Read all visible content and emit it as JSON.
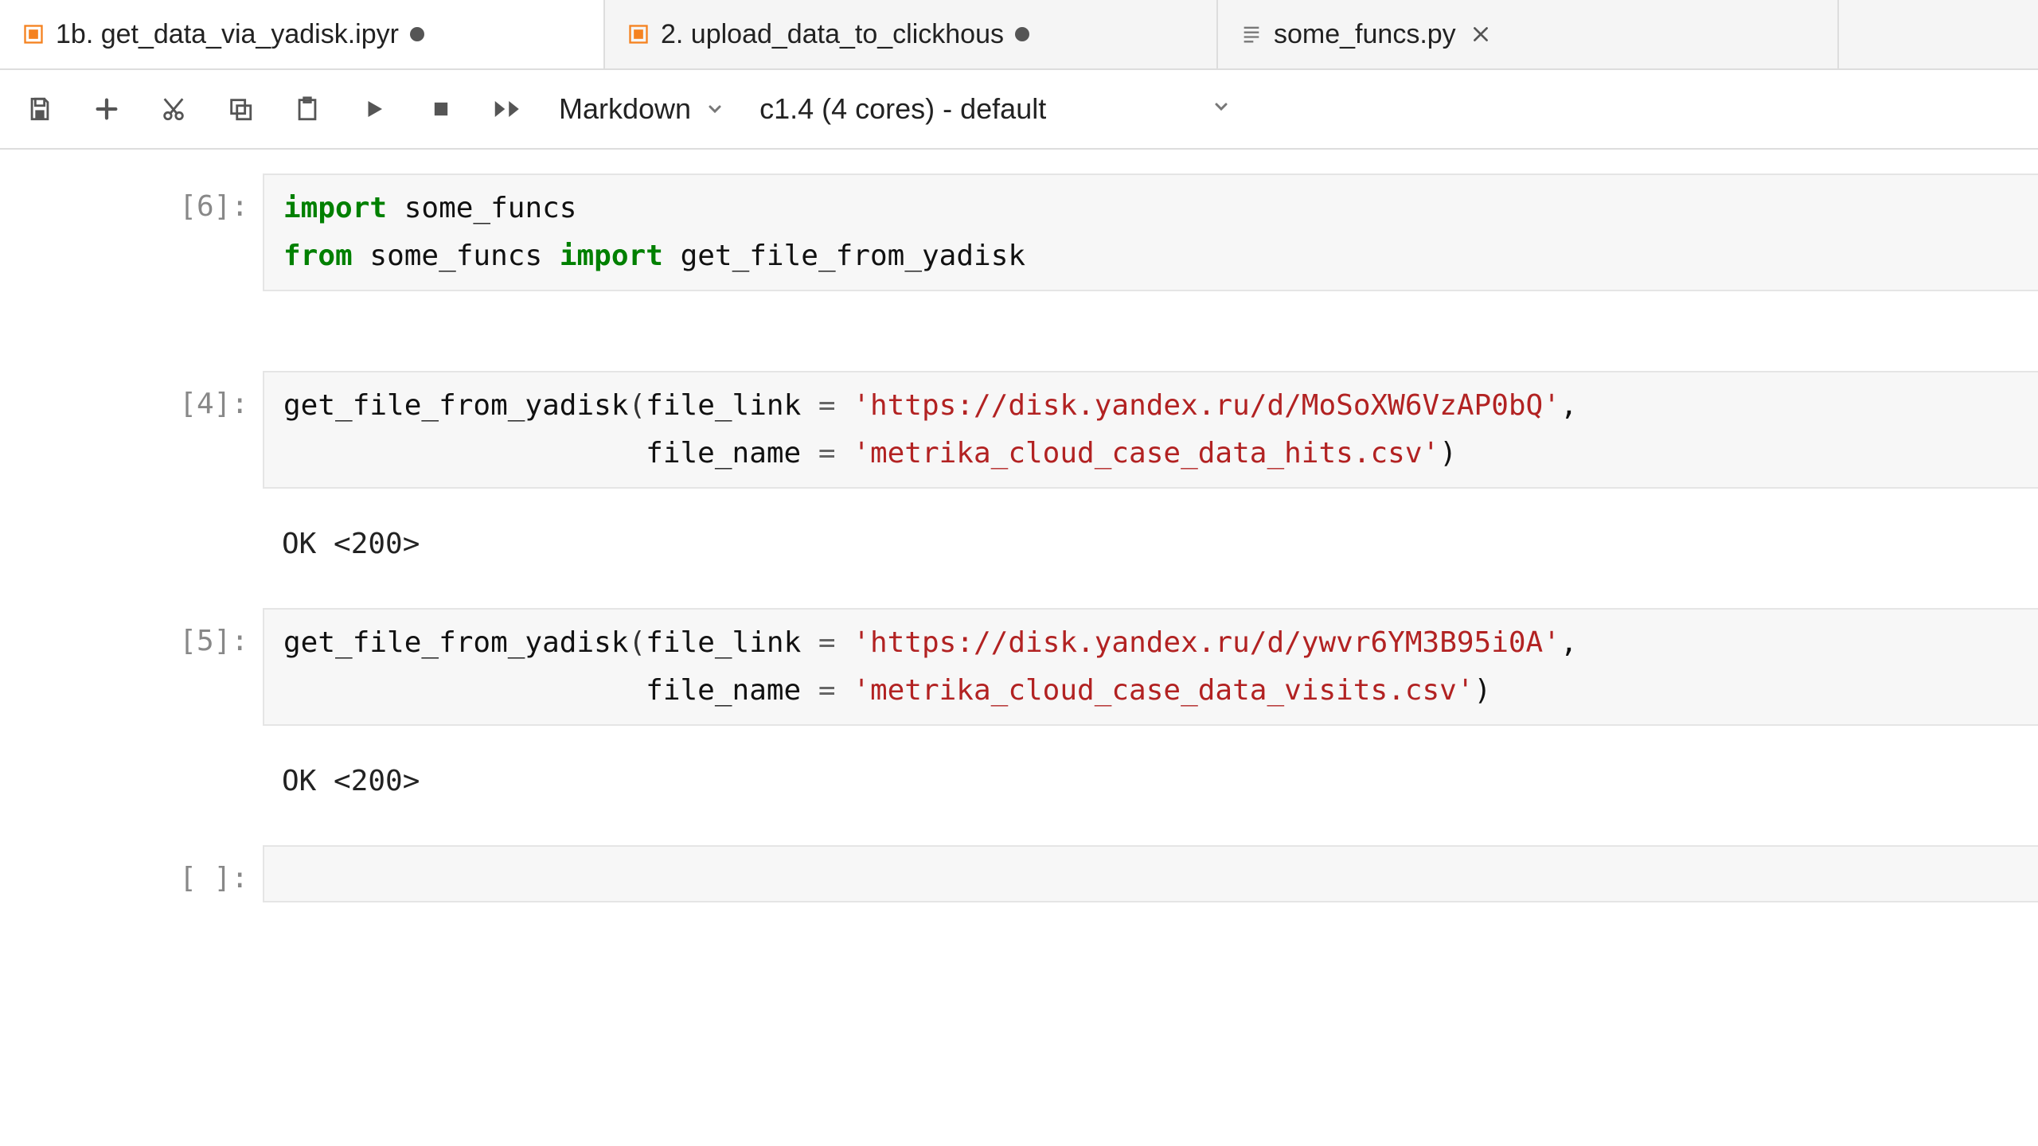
{
  "tabs": [
    {
      "label": "1b. get_data_via_yadisk.ipyr",
      "type": "notebook",
      "unsaved": true
    },
    {
      "label": "2. upload_data_to_clickhous",
      "type": "notebook",
      "unsaved": true
    },
    {
      "label": "some_funcs.py",
      "type": "python",
      "unsaved": false
    }
  ],
  "toolbar": {
    "celltype": "Markdown",
    "kernel": "c1.4 (4 cores) - default"
  },
  "cells": [
    {
      "prompt": "[6]:",
      "code": {
        "line1": {
          "kw1": "import",
          "mod1": "some_funcs"
        },
        "line2": {
          "kw1": "from",
          "mod1": "some_funcs",
          "kw2": "import",
          "name1": "get_file_from_yadisk"
        }
      }
    },
    {
      "prompt": "[4]:",
      "code": {
        "line1": {
          "fn": "get_file_from_yadisk",
          "arg1": "file_link",
          "eq": " = ",
          "str1": "'https://disk.yandex.ru/d/MoSoXW6VzAP0bQ'",
          "comma": ","
        },
        "line2": {
          "pad": "                     ",
          "arg1": "file_name",
          "eq": " = ",
          "str1": "'metrika_cloud_case_data_hits.csv'",
          "close": ")"
        }
      },
      "output": "OK <200>"
    },
    {
      "prompt": "[5]:",
      "code": {
        "line1": {
          "fn": "get_file_from_yadisk",
          "arg1": "file_link",
          "eq": " = ",
          "str1": "'https://disk.yandex.ru/d/ywvr6YM3B95i0A'",
          "comma": ","
        },
        "line2": {
          "pad": "                     ",
          "arg1": "file_name",
          "eq": " = ",
          "str1": "'metrika_cloud_case_data_visits.csv'",
          "close": ")"
        }
      },
      "output": "OK <200>"
    },
    {
      "prompt": "[ ]:",
      "empty": true
    }
  ]
}
